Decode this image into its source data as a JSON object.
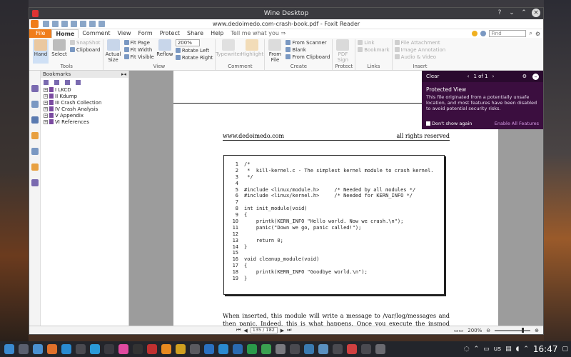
{
  "window": {
    "title": "Wine Desktop",
    "doc_title": "www.dedoimedo.com-crash-book.pdf - Foxit Reader"
  },
  "menu": {
    "tabs": [
      "File",
      "Home",
      "Comment",
      "View",
      "Form",
      "Protect",
      "Share",
      "Help"
    ],
    "active": "Home",
    "tellme": "Tell me what you ⇒",
    "find_placeholder": "Find"
  },
  "ribbon": {
    "tools": {
      "name": "Tools",
      "hand": "Hand",
      "select": "Select",
      "snapshot": "SnapShot",
      "clipboard": "Clipboard"
    },
    "view": {
      "name": "View",
      "actual_size": "Actual Size",
      "fit_page": "Fit Page",
      "fit_width": "Fit Width",
      "fit_visible": "Fit Visible",
      "reflow": "Reflow",
      "zoom": "200%",
      "rotate_left": "Rotate Left",
      "rotate_right": "Rotate Right"
    },
    "comment": {
      "name": "Comment",
      "typewriter": "Typewriter",
      "highlight": "Highlight"
    },
    "create": {
      "name": "Create",
      "from_file": "From File",
      "from_scanner": "From Scanner",
      "blank": "Blank",
      "from_clipboard": "From Clipboard"
    },
    "protect": {
      "name": "Protect",
      "pdf_sign": "PDF Sign"
    },
    "links": {
      "name": "Links",
      "link": "Link",
      "bookmark": "Bookmark"
    },
    "insert": {
      "name": "Insert",
      "file_attachment": "File Attachment",
      "image_annotation": "Image Annotation",
      "audio_video": "Audio & Video"
    }
  },
  "bookmarks": {
    "title": "Bookmarks",
    "items": [
      "I LKCD",
      "II Kdump",
      "III Crash Collection",
      "IV Crash Analysis",
      "V Appendix",
      "VI References"
    ]
  },
  "page": {
    "running_head_left": "www.dedoimedo.com",
    "running_head_right": "all rights reserved",
    "code": [
      {
        "n": "1",
        "t": "/*"
      },
      {
        "n": "2",
        "t": " *  kill-kernel.c - The simplest kernel module to crash kernel."
      },
      {
        "n": "3",
        "t": " */"
      },
      {
        "n": "4",
        "t": ""
      },
      {
        "n": "5",
        "t": "#include <linux/module.h>     /* Needed by all modules */"
      },
      {
        "n": "6",
        "t": "#include <linux/kernel.h>     /* Needed for KERN_INFO */"
      },
      {
        "n": "7",
        "t": ""
      },
      {
        "n": "8",
        "t": "int init_module(void)"
      },
      {
        "n": "9",
        "t": "{"
      },
      {
        "n": "10",
        "t": "    printk(KERN_INFO \"Hello world. Now we crash.\\n\");"
      },
      {
        "n": "11",
        "t": "    panic(\"Down we go, panic called!\");"
      },
      {
        "n": "12",
        "t": ""
      },
      {
        "n": "13",
        "t": "    return 0;"
      },
      {
        "n": "14",
        "t": "}"
      },
      {
        "n": "15",
        "t": ""
      },
      {
        "n": "16",
        "t": "void cleanup_module(void)"
      },
      {
        "n": "17",
        "t": "{"
      },
      {
        "n": "18",
        "t": "    printk(KERN_INFO \"Goodbye world.\\n\");"
      },
      {
        "n": "19",
        "t": "}"
      }
    ],
    "body": "When inserted, this module will write a message to /var/log/messages and then panic. Indeed, this is what happens. Once you execute the insmod command, the machine will freeze, reboot, dump the kernel memory and then reboot back into the production kernel."
  },
  "protected_view": {
    "clear": "Clear",
    "pager": "1 of 1",
    "title": "Protected View",
    "message": "This file originated from a potentially unsafe location, and most features have been disabled to avoid potential security risks.",
    "dont_show": "Don't show again",
    "enable": "Enable All Features"
  },
  "status": {
    "page_value": "135 / 182",
    "zoom": "200%"
  },
  "taskbar": {
    "clock": "16:47",
    "lang": "us"
  }
}
